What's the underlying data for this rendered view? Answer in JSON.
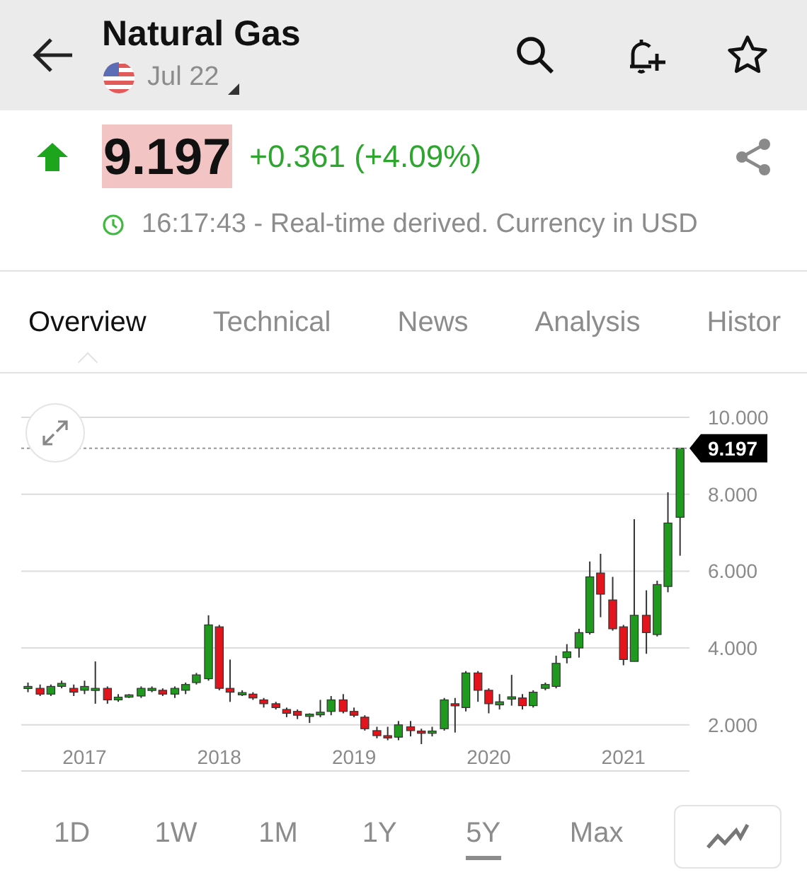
{
  "header": {
    "title": "Natural Gas",
    "contract": "Jul 22"
  },
  "quote": {
    "price": "9.197",
    "change": "+0.361 (+4.09%)",
    "rising": true,
    "status": "16:17:43 - Real-time derived. Currency in USD"
  },
  "tabs": [
    {
      "label": "Overview",
      "selected": true
    },
    {
      "label": "Technical",
      "selected": false
    },
    {
      "label": "News",
      "selected": false
    },
    {
      "label": "Analysis",
      "selected": false
    },
    {
      "label": "Histor",
      "selected": false
    }
  ],
  "chart": {
    "chart_data": {
      "type": "candlestick",
      "grid": true,
      "xlim": [
        2016.53,
        2021.49
      ],
      "ylim": [
        0.8,
        10
      ],
      "yticks": [
        {
          "value": 2,
          "label": "2.000"
        },
        {
          "value": 4,
          "label": "4.000"
        },
        {
          "value": 6,
          "label": "6.000"
        },
        {
          "value": 8,
          "label": "8.000"
        },
        {
          "value": 10,
          "label": "10.000"
        }
      ],
      "xticks": [
        2017,
        2018,
        2019,
        2020,
        2021
      ],
      "ref_lines": [
        {
          "axis": "y",
          "value": 9.197,
          "label": "9.197"
        }
      ],
      "x": [
        2016.58,
        2016.67,
        2016.75,
        2016.83,
        2016.92,
        2017.0,
        2017.08,
        2017.17,
        2017.25,
        2017.33,
        2017.42,
        2017.5,
        2017.58,
        2017.67,
        2017.75,
        2017.83,
        2017.92,
        2018.0,
        2018.08,
        2018.17,
        2018.25,
        2018.33,
        2018.42,
        2018.5,
        2018.58,
        2018.67,
        2018.75,
        2018.83,
        2018.92,
        2019.0,
        2019.08,
        2019.17,
        2019.25,
        2019.33,
        2019.42,
        2019.5,
        2019.58,
        2019.67,
        2019.75,
        2019.83,
        2019.92,
        2020.0,
        2020.08,
        2020.17,
        2020.25,
        2020.33,
        2020.42,
        2020.5,
        2020.58,
        2020.67,
        2020.75,
        2020.83,
        2020.92,
        2021.0,
        2021.08,
        2021.17,
        2021.25,
        2021.33,
        2021.42
      ],
      "ohlc": [
        [
          2.95,
          3.1,
          2.85,
          3.0
        ],
        [
          2.95,
          3.05,
          2.75,
          2.8
        ],
        [
          2.8,
          3.05,
          2.75,
          3.0
        ],
        [
          3.0,
          3.15,
          2.95,
          3.08
        ],
        [
          2.95,
          3.05,
          2.75,
          2.85
        ],
        [
          2.9,
          3.15,
          2.8,
          3.0
        ],
        [
          2.95,
          3.65,
          2.55,
          2.95
        ],
        [
          2.95,
          3.0,
          2.55,
          2.65
        ],
        [
          2.65,
          2.8,
          2.6,
          2.72
        ],
        [
          2.72,
          2.8,
          2.7,
          2.78
        ],
        [
          2.75,
          3.0,
          2.7,
          2.95
        ],
        [
          2.95,
          3.0,
          2.85,
          2.95
        ],
        [
          2.9,
          2.95,
          2.75,
          2.8
        ],
        [
          2.8,
          3.0,
          2.7,
          2.95
        ],
        [
          2.9,
          3.1,
          2.8,
          3.05
        ],
        [
          3.1,
          3.35,
          3.05,
          3.3
        ],
        [
          3.2,
          4.85,
          3.15,
          4.6
        ],
        [
          4.55,
          4.6,
          2.9,
          2.95
        ],
        [
          2.95,
          3.7,
          2.6,
          2.85
        ],
        [
          2.78,
          2.9,
          2.75,
          2.84
        ],
        [
          2.8,
          2.85,
          2.65,
          2.7
        ],
        [
          2.65,
          2.7,
          2.45,
          2.55
        ],
        [
          2.55,
          2.6,
          2.4,
          2.45
        ],
        [
          2.4,
          2.45,
          2.2,
          2.3
        ],
        [
          2.35,
          2.4,
          2.15,
          2.25
        ],
        [
          2.22,
          2.3,
          2.05,
          2.28
        ],
        [
          2.26,
          2.65,
          2.2,
          2.33
        ],
        [
          2.35,
          2.75,
          2.25,
          2.65
        ],
        [
          2.65,
          2.8,
          2.3,
          2.35
        ],
        [
          2.35,
          2.45,
          2.2,
          2.25
        ],
        [
          2.2,
          2.25,
          1.85,
          1.9
        ],
        [
          1.85,
          1.95,
          1.65,
          1.72
        ],
        [
          1.72,
          1.95,
          1.6,
          1.66
        ],
        [
          1.68,
          2.1,
          1.6,
          2.0
        ],
        [
          1.95,
          2.1,
          1.7,
          1.85
        ],
        [
          1.84,
          1.9,
          1.5,
          1.78
        ],
        [
          1.78,
          1.95,
          1.7,
          1.84
        ],
        [
          1.9,
          2.7,
          1.85,
          2.65
        ],
        [
          2.55,
          2.7,
          1.8,
          2.5
        ],
        [
          2.45,
          3.4,
          2.35,
          3.35
        ],
        [
          3.35,
          3.4,
          2.6,
          2.9
        ],
        [
          2.9,
          2.95,
          2.3,
          2.55
        ],
        [
          2.52,
          2.8,
          2.4,
          2.6
        ],
        [
          2.67,
          3.3,
          2.5,
          2.73
        ],
        [
          2.7,
          2.8,
          2.4,
          2.5
        ],
        [
          2.5,
          2.9,
          2.45,
          2.85
        ],
        [
          2.95,
          3.1,
          2.9,
          3.05
        ],
        [
          3.0,
          3.8,
          2.95,
          3.6
        ],
        [
          3.75,
          4.1,
          3.6,
          3.9
        ],
        [
          4.0,
          4.5,
          3.75,
          4.4
        ],
        [
          4.4,
          6.25,
          4.35,
          5.85
        ],
        [
          5.95,
          6.45,
          4.8,
          5.4
        ],
        [
          5.25,
          5.85,
          4.45,
          4.5
        ],
        [
          4.55,
          4.6,
          3.55,
          3.7
        ],
        [
          3.65,
          7.35,
          3.65,
          4.85
        ],
        [
          4.85,
          5.5,
          3.85,
          4.4
        ],
        [
          4.35,
          5.75,
          4.3,
          5.65
        ],
        [
          5.6,
          8.05,
          5.45,
          7.25
        ],
        [
          7.4,
          9.197,
          6.4,
          9.197
        ]
      ]
    }
  },
  "ranges": [
    {
      "label": "1D",
      "selected": false
    },
    {
      "label": "1W",
      "selected": false
    },
    {
      "label": "1M",
      "selected": false
    },
    {
      "label": "1Y",
      "selected": false
    },
    {
      "label": "5Y",
      "selected": true
    },
    {
      "label": "Max",
      "selected": false
    }
  ]
}
